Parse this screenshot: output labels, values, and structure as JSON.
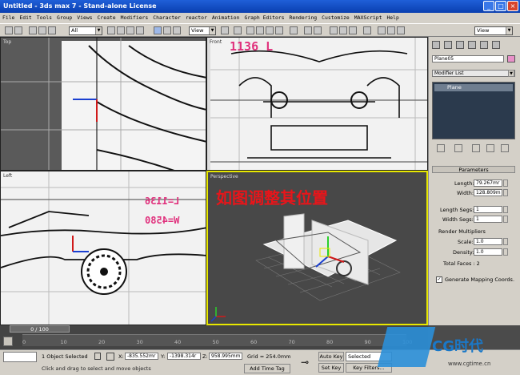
{
  "titlebar": {
    "title": "Untitled  - 3ds max 7  - Stand-alone License"
  },
  "menus": [
    "File",
    "Edit",
    "Tools",
    "Group",
    "Views",
    "Create",
    "Modifiers",
    "Character",
    "reactor",
    "Animation",
    "Graph Editors",
    "Rendering",
    "Customize",
    "MAXScript",
    "Help"
  ],
  "toolbar": {
    "filter_value": "All",
    "view_value": "View",
    "view_value_right": "View"
  },
  "viewports": {
    "top": "Top",
    "front": "Front",
    "left": "Left",
    "perspective": "Perspective"
  },
  "annotations": {
    "front_text": "1136 L",
    "left_text1": "L=1136",
    "left_text2": "W=4580",
    "chinese": "如图调整其位置"
  },
  "cmd": {
    "object_name": "Plane05",
    "modifier_list": "Modifier List",
    "stack_item": "Plane",
    "params_header": "Parameters",
    "length_label": "Length:",
    "length_value": "79.267mr",
    "width_label": "Width:",
    "width_value": "128.809m",
    "length_segs_label": "Length Segs:",
    "length_segs_value": "1",
    "width_segs_label": "Width Segs:",
    "width_segs_value": "1",
    "render_mult": "Render Multipliers",
    "scale_label": "Scale:",
    "scale_value": "1.0",
    "density_label": "Density:",
    "density_value": "1.0",
    "total_faces": "Total Faces : 2",
    "gen_coords": "Generate Mapping Coords."
  },
  "timeline": {
    "frame_counter": "0 / 100",
    "ticks": [
      "0",
      "10",
      "20",
      "30",
      "40",
      "50",
      "60",
      "70",
      "80",
      "90",
      "100"
    ]
  },
  "status": {
    "selection": "1 Object Selected",
    "prompt": "Click and drag to select and move objects",
    "x_label": "X:",
    "x_value": "-835.552mr",
    "y_label": "Y:",
    "y_value": "-1398.314r",
    "z_label": "Z:",
    "z_value": "958.995mm",
    "grid": "Grid = 254.0mm",
    "add_time_tag": "Add Time Tag",
    "auto_key": "Auto Key",
    "selected": "Selected",
    "set_key": "Set Key",
    "key_filters": "Key Filters...",
    "logo_text": "CG时代",
    "logo_url": "www.cgtime.cn"
  }
}
